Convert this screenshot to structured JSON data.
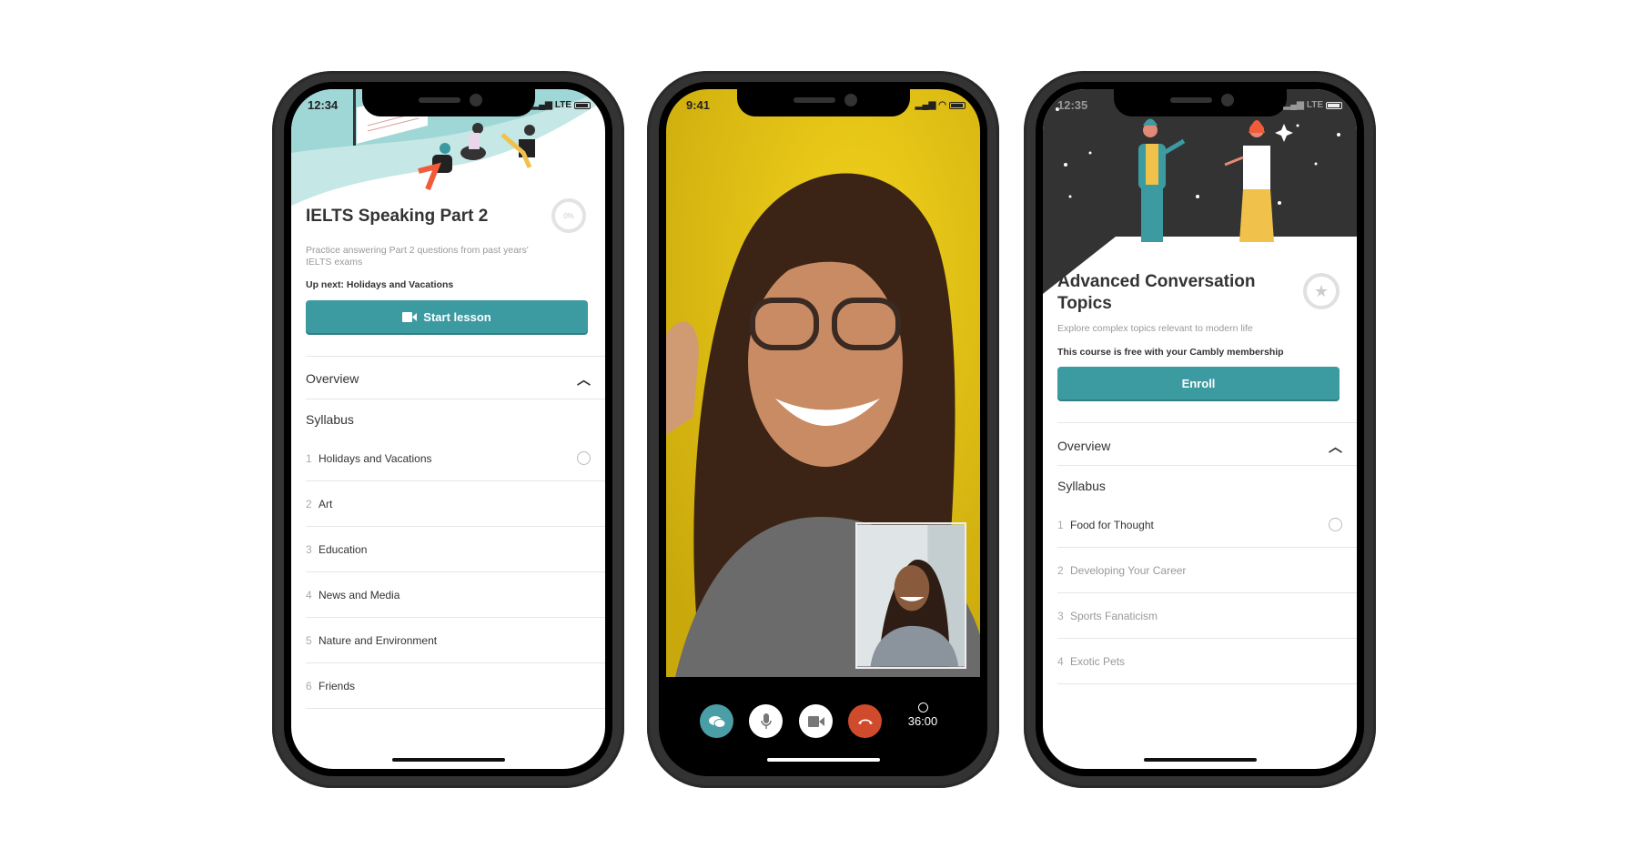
{
  "phones": [
    {
      "status_time": "12:34",
      "status_net": "LTE",
      "course": {
        "title": "IELTS Speaking Part 2",
        "progress_label": "0%",
        "progress": 0,
        "description": "Practice answering Part 2 questions from past years' IELTS exams",
        "up_next": "Up next: Holidays and Vacations",
        "cta_label": "Start lesson",
        "overview_label": "Overview",
        "syllabus_label": "Syllabus",
        "items": [
          {
            "num": "1",
            "label": "Holidays and Vacations"
          },
          {
            "num": "2",
            "label": "Art"
          },
          {
            "num": "3",
            "label": "Education"
          },
          {
            "num": "4",
            "label": "News and Media"
          },
          {
            "num": "5",
            "label": "Nature and Environment"
          },
          {
            "num": "6",
            "label": "Friends"
          }
        ]
      }
    },
    {
      "status_time": "9:41",
      "call": {
        "timer": "36:00",
        "controls": [
          "chat-icon",
          "microphone-icon",
          "video-camera-icon",
          "hang-up-icon"
        ],
        "colors": {
          "chat": "#4a9ea5",
          "hangup": "#d04a2c"
        }
      }
    },
    {
      "status_time": "12:35",
      "status_net": "LTE",
      "course": {
        "title": "Advanced Conversation Topics",
        "description": "Explore complex topics relevant to modern life",
        "membership_note": "This course is free with your Cambly membership",
        "cta_label": "Enroll",
        "overview_label": "Overview",
        "syllabus_label": "Syllabus",
        "items": [
          {
            "num": "1",
            "label": "Food for Thought"
          },
          {
            "num": "2",
            "label": "Developing Your Career"
          },
          {
            "num": "3",
            "label": "Sports Fanaticism"
          },
          {
            "num": "4",
            "label": "Exotic Pets"
          }
        ]
      }
    }
  ],
  "colors": {
    "accent": "#3c9aa1",
    "header_teal": "#9fd6d6",
    "header_dark": "#333333"
  }
}
